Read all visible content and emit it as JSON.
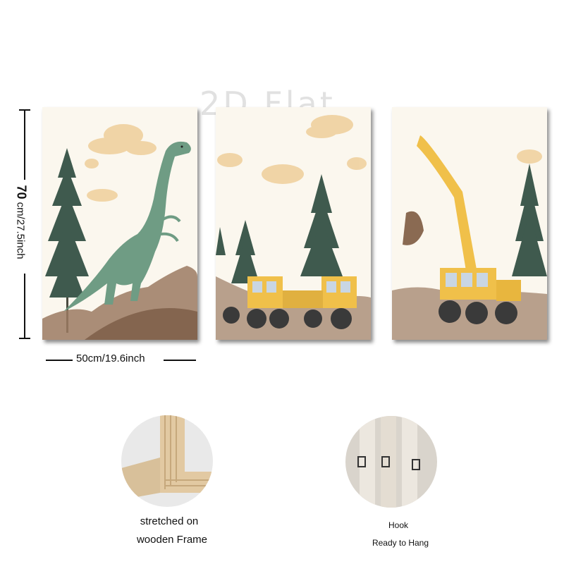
{
  "watermark": "2D Flat",
  "dimensions": {
    "height_main": "70",
    "height_rest": " cm/27.5inch",
    "width": "50cm/19.6inch"
  },
  "panels": [
    {
      "subject": "dinosaur"
    },
    {
      "subject": "dump-trucks"
    },
    {
      "subject": "excavator"
    }
  ],
  "features": {
    "frame_line1": "stretched on",
    "frame_line2": "wooden Frame",
    "hook_line1": "Hook",
    "hook_line2": "Ready to Hang"
  },
  "colors": {
    "sky": "#fbf7ee",
    "cloud": "#efcf9a",
    "tree": "#3f5a4e",
    "dirt": "#9b7a62",
    "dino": "#6f9c84",
    "truck": "#f0c04a",
    "wheel": "#3a3a3a"
  }
}
